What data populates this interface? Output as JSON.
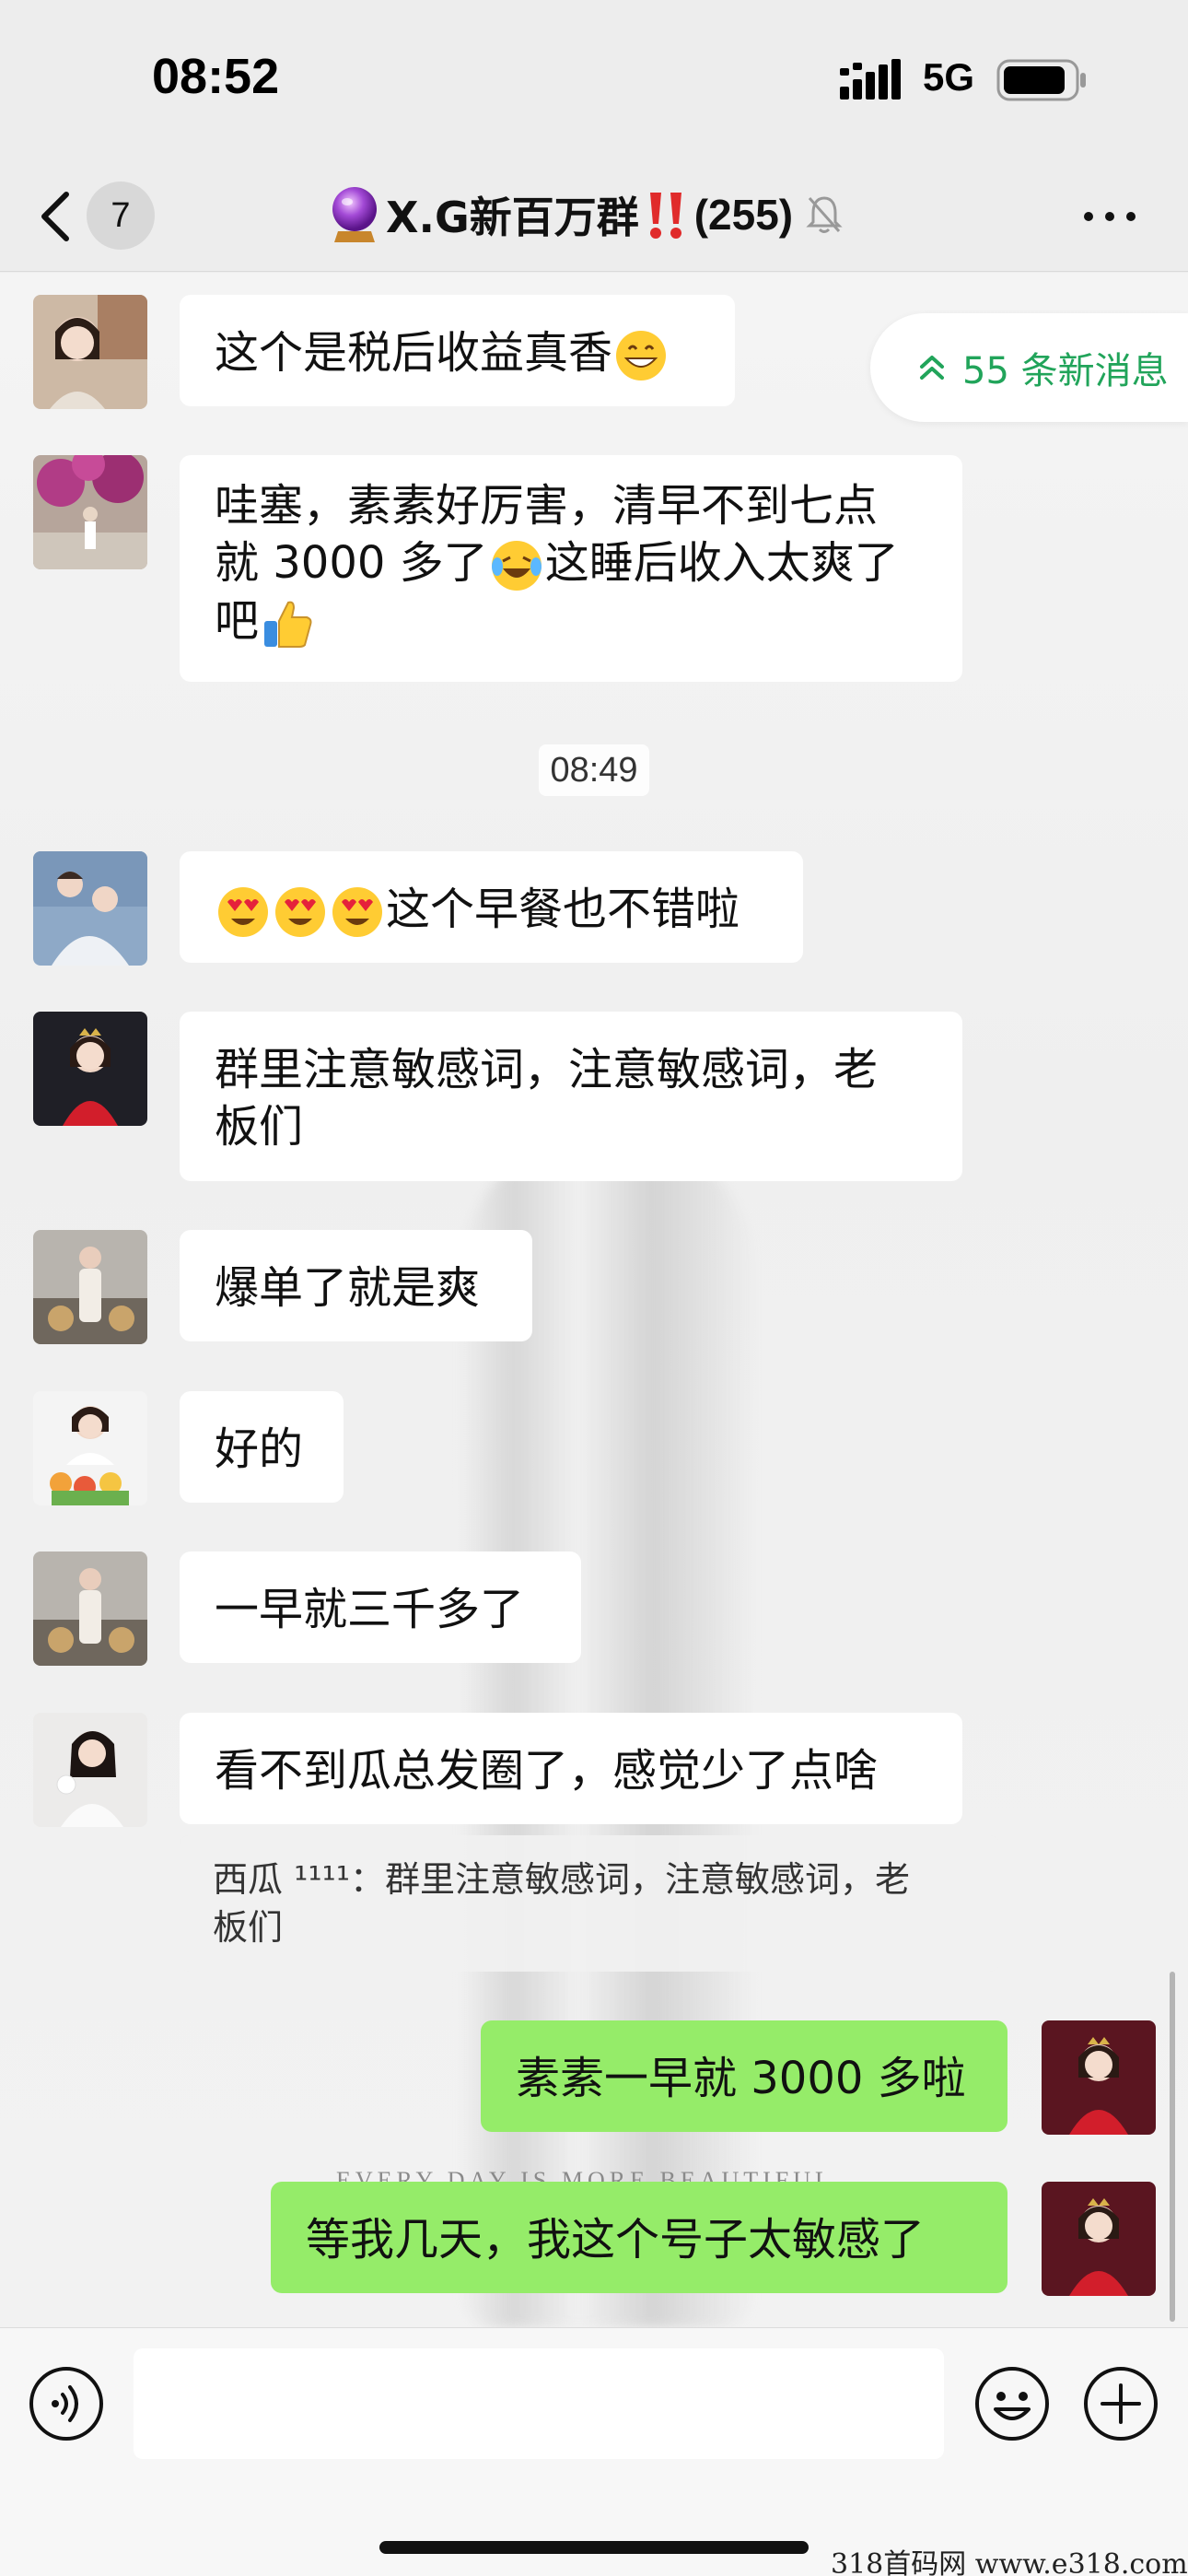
{
  "status_bar": {
    "time": "08:52",
    "network": "5G"
  },
  "nav": {
    "unread_count": "7",
    "title": "X.G新百万群",
    "member_count": "(255)"
  },
  "new_messages_pill": "55 条新消息",
  "timestamp": "08:49",
  "messages": [
    {
      "text": "这个是税后收益真香"
    },
    {
      "line1": "哇塞，素素好厉害，清早不到七点",
      "line2": "就 3000 多了",
      "line2_tail": "这睡后收入太爽了",
      "line3": "吧"
    },
    {
      "text": "这个早餐也不错啦"
    },
    {
      "line1": "群里注意敏感词，注意敏感词，老",
      "line2": "板们"
    },
    {
      "text": "爆单了就是爽"
    },
    {
      "text": "好的"
    },
    {
      "text": "一早就三千多了"
    },
    {
      "text": "看不到瓜总发圈了，感觉少了点啥"
    },
    {
      "text": "素素一早就 3000 多啦"
    },
    {
      "text": "等我几天，我这个号子太敏感了"
    }
  ],
  "quote": {
    "line1": "西瓜 ¹¹¹¹：群里注意敏感词，注意敏感词，老",
    "line2": "板们"
  },
  "background_caption": "EVERY DAY IS MORE BEAUTIFUL",
  "watermark": "318首码网  www.e318.com",
  "colors": {
    "my_bubble": "#95ec69",
    "accent_green": "#21a45a",
    "page_bg": "#ededed"
  },
  "icons": [
    "back-chevron-icon",
    "crystal-ball-icon",
    "double-exclamation-icon",
    "mute-bell-icon",
    "more-dots-icon",
    "double-chevron-up-icon",
    "voice-icon",
    "emoji-icon",
    "plus-icon",
    "grinning-emoji",
    "crying-laughing-emoji",
    "thumbs-up-emoji",
    "heart-eyes-emoji"
  ]
}
